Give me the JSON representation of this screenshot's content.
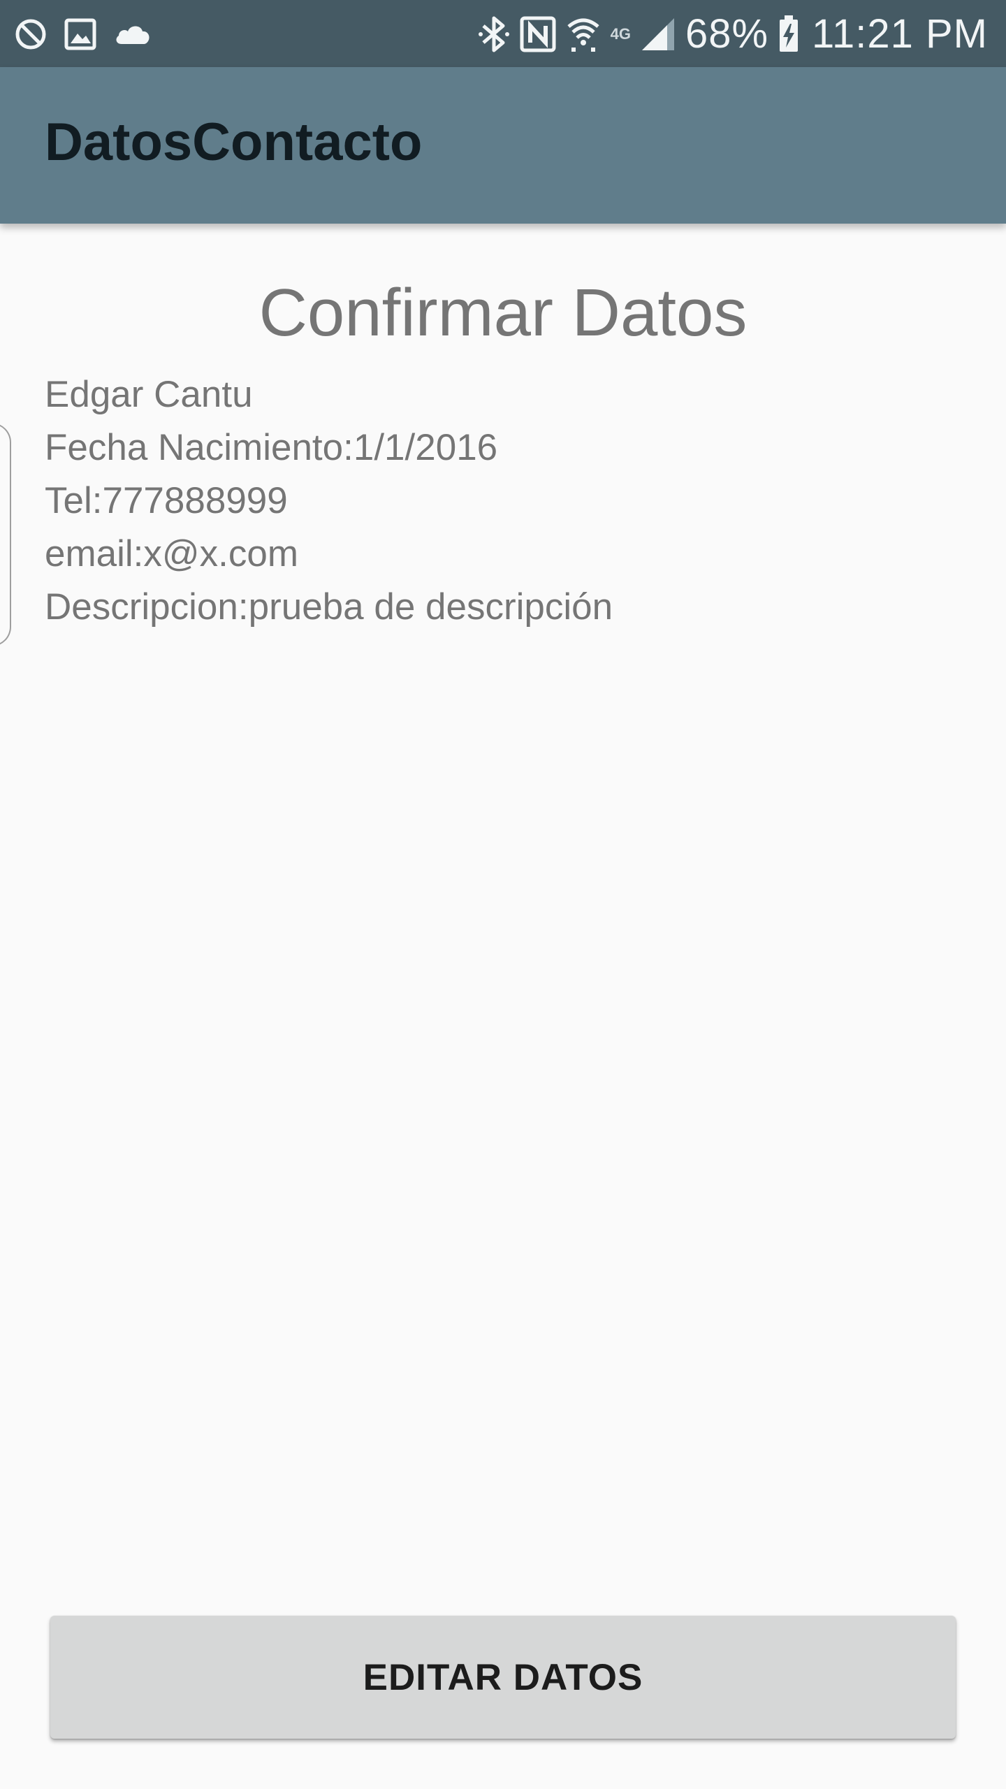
{
  "status_bar": {
    "left_icons": [
      "do-not-disturb-icon",
      "gallery-icon",
      "cloud-icon"
    ],
    "right_icons": [
      "bluetooth-icon",
      "nfc-icon",
      "wifi-icon",
      "lte-icon",
      "signal-icon",
      "battery-charging-icon"
    ],
    "network_type": "4G",
    "battery": "68%",
    "time": "11:21 PM"
  },
  "app_bar": {
    "title": "DatosContacto"
  },
  "main": {
    "heading": "Confirmar Datos",
    "details": [
      "Edgar Cantu",
      "Fecha Nacimiento:1/1/2016",
      "Tel:777888999",
      "email:x@x.com",
      "Descripcion:prueba de descripción"
    ],
    "edit_button_label": "EDITAR DATOS"
  },
  "colors": {
    "status_bar_bg": "#455a64",
    "app_bar_bg": "#607d8b",
    "background": "#fafafa",
    "text_secondary": "#757575",
    "button_bg": "#d6d7d7"
  }
}
